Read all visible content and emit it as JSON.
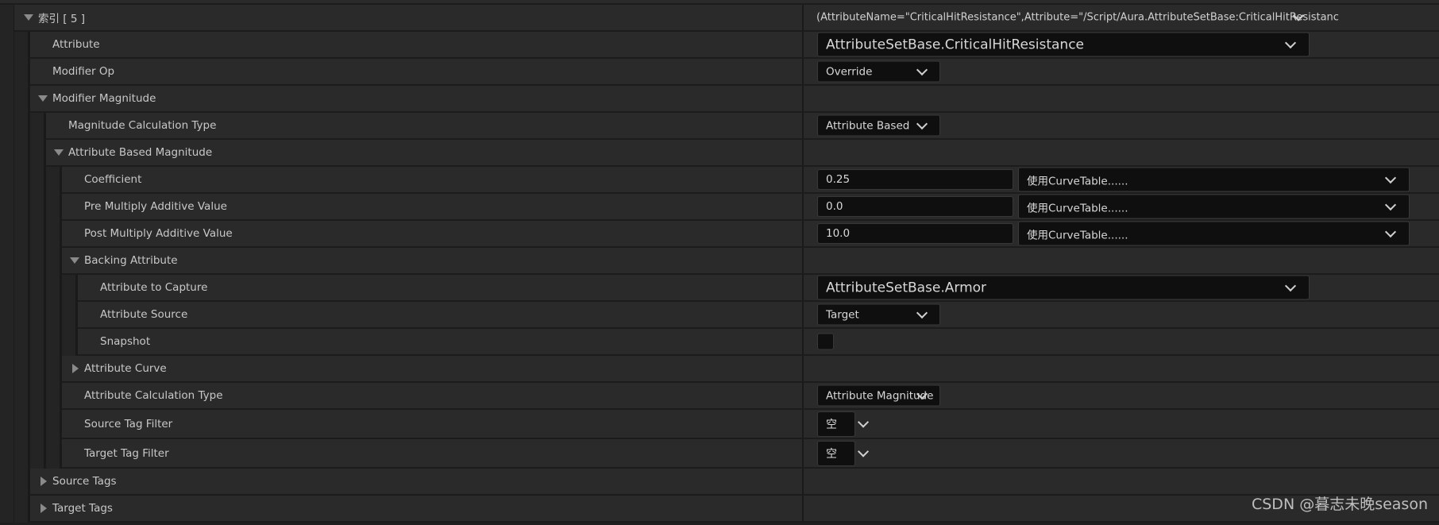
{
  "rows": [
    {
      "label": "索引 [ 5 ]",
      "level": 0,
      "expander": "down",
      "value": {
        "type": "text",
        "text": "(AttributeName=\"CriticalHitResistance\",Attribute=\"/Script/Aura.AttributeSetBase:CriticalHitResistanc"
      }
    },
    {
      "label": "Attribute",
      "level": 1,
      "value": {
        "type": "combo-large",
        "text": "AttributeSetBase.CriticalHitResistance"
      }
    },
    {
      "label": "Modifier Op",
      "level": 1,
      "value": {
        "type": "combo",
        "text": "Override"
      }
    },
    {
      "label": "Modifier Magnitude",
      "level": 1,
      "expander": "down"
    },
    {
      "label": "Magnitude Calculation Type",
      "level": 2,
      "value": {
        "type": "combo",
        "text": "Attribute Based"
      }
    },
    {
      "label": "Attribute Based Magnitude",
      "level": 2,
      "expander": "down"
    },
    {
      "label": "Coefficient",
      "level": 3,
      "value": {
        "type": "number-curve",
        "text": "0.25",
        "curve": "使用CurveTable......"
      }
    },
    {
      "label": "Pre Multiply Additive Value",
      "level": 3,
      "value": {
        "type": "number-curve",
        "text": "0.0",
        "curve": "使用CurveTable......"
      }
    },
    {
      "label": "Post Multiply Additive Value",
      "level": 3,
      "value": {
        "type": "number-curve",
        "text": "10.0",
        "curve": "使用CurveTable......"
      }
    },
    {
      "label": "Backing Attribute",
      "level": 3,
      "expander": "down"
    },
    {
      "label": "Attribute to Capture",
      "level": 4,
      "value": {
        "type": "combo-large",
        "text": "AttributeSetBase.Armor"
      }
    },
    {
      "label": "Attribute Source",
      "level": 4,
      "value": {
        "type": "combo",
        "text": "Target"
      }
    },
    {
      "label": "Snapshot",
      "level": 4,
      "value": {
        "type": "checkbox",
        "checked": false
      }
    },
    {
      "label": "Attribute Curve",
      "level": 3,
      "expander": "right"
    },
    {
      "label": "Attribute Calculation Type",
      "level": 3,
      "value": {
        "type": "combo",
        "text": "Attribute Magnitude"
      }
    },
    {
      "label": "Source Tag Filter",
      "level": 3,
      "tall": true,
      "value": {
        "type": "tag",
        "text": "空"
      }
    },
    {
      "label": "Target Tag Filter",
      "level": 3,
      "tall": true,
      "value": {
        "type": "tag",
        "text": "空"
      }
    },
    {
      "label": "Source Tags",
      "level": 1,
      "expander": "right"
    },
    {
      "label": "Target Tags",
      "level": 1,
      "expander": "right"
    }
  ],
  "watermark": "CSDN @暮志未晚season"
}
